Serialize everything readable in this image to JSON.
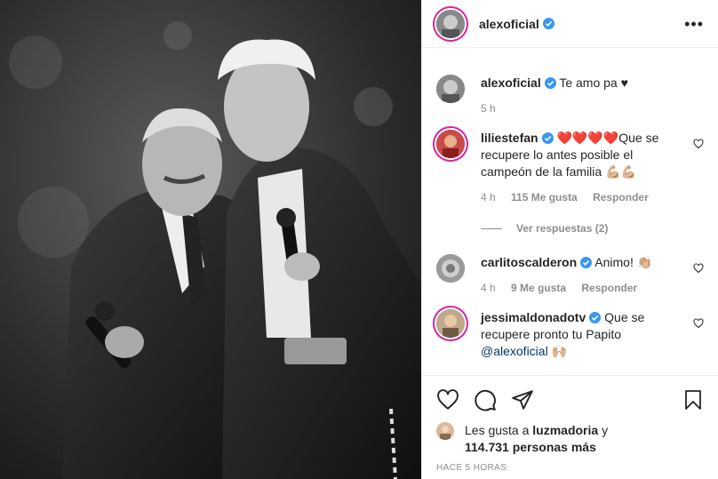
{
  "post": {
    "author": "alexoficial",
    "more_label": "•••"
  },
  "caption": {
    "username": "alexoficial",
    "text": "Te amo pa ♥",
    "time": "5 h"
  },
  "comments": [
    {
      "username": "liliestefan",
      "text": "❤️❤️❤️❤️Que se recupere lo antes posible el campeón de la familia 💪🏼💪🏼",
      "time": "4 h",
      "likes": "115 Me gusta",
      "reply": "Responder",
      "view_replies": "Ver respuestas (2)"
    },
    {
      "username": "carlitoscalderon",
      "text": "Animo! 👏🏼",
      "time": "4 h",
      "likes": "9 Me gusta",
      "reply": "Responder"
    },
    {
      "username": "jessimaldonadotv",
      "text": "Que se recupere pronto tu Papito",
      "mention": "@alexoficial",
      "emoji": "🙌🏼"
    }
  ],
  "likes": {
    "prefix": "Les gusta a ",
    "user": "luzmadoria",
    "middle": " y",
    "count": "114.731 personas más"
  },
  "timestamp": "HACE 5 HORAS",
  "colors": {
    "verified": "#3897f0",
    "text": "#262626",
    "muted": "#8e8e8e",
    "mention": "#00376b"
  },
  "icons": [
    "heart-icon",
    "comment-icon",
    "share-icon",
    "bookmark-icon",
    "verified-badge-icon",
    "more-options-icon"
  ]
}
